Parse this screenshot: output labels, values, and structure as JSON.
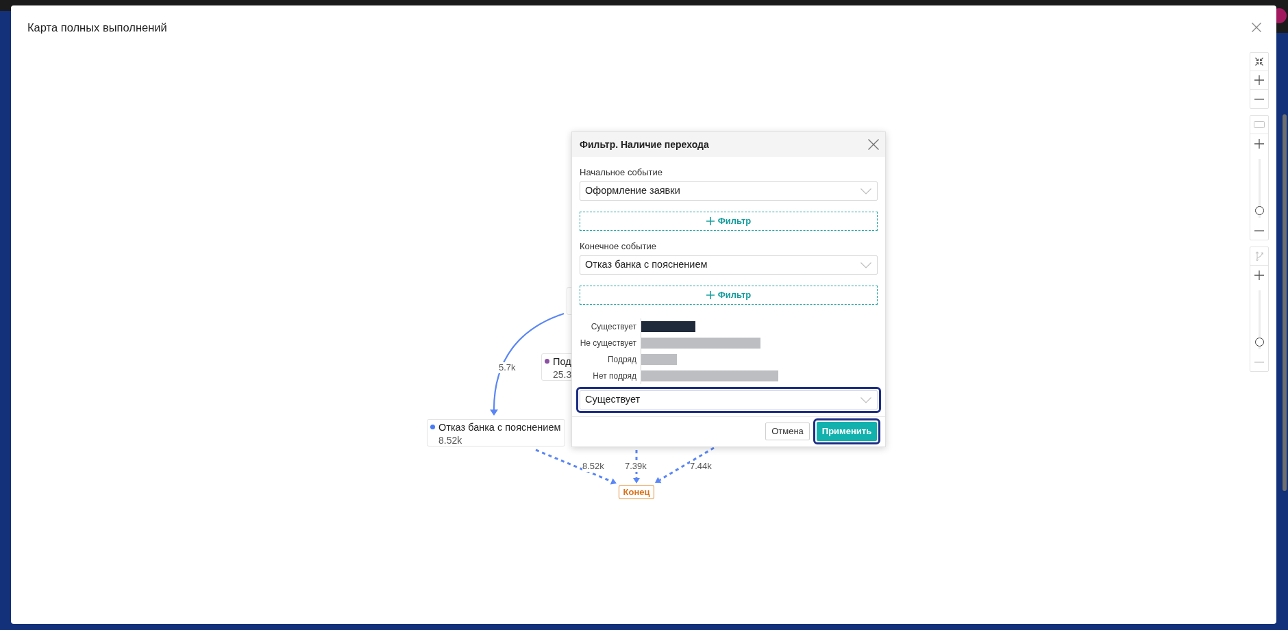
{
  "window": {
    "title": "Карта полных выполнений"
  },
  "graph": {
    "nodes": [
      {
        "kind": "covered"
      },
      {
        "kind": "event",
        "label": "Под",
        "value": "25.3",
        "color": "#8b4fa3"
      },
      {
        "kind": "event",
        "label": "Отказ банка с пояснением",
        "value": "8.52k",
        "color": "#4a7cf7"
      },
      {
        "kind": "end",
        "label": "Конец"
      }
    ],
    "edges": [
      {
        "label": "5.7k",
        "dashed": false
      },
      {
        "label": "8.52k",
        "dashed": true
      },
      {
        "label": "7.39k",
        "dashed": true
      },
      {
        "label": "7.44k",
        "dashed": true
      }
    ]
  },
  "filter_dialog": {
    "title": "Фильтр. Наличие перехода",
    "start_event": {
      "label": "Начальное событие",
      "value": "Оформление заявки",
      "filter_button": "Фильтр"
    },
    "end_event": {
      "label": "Конечное событие",
      "value": "Отказ банка с пояснением",
      "filter_button": "Фильтр"
    },
    "transition_chart": {
      "bars": [
        {
          "label": "Существует",
          "selected": true
        },
        {
          "label": "Не существует",
          "selected": false
        },
        {
          "label": "Подряд",
          "selected": false
        },
        {
          "label": "Нет подряд",
          "selected": false
        }
      ]
    },
    "transition_select": {
      "value": "Существует",
      "highlighted": true
    },
    "buttons": [
      {
        "label": "Отмена",
        "kind": "secondary",
        "highlighted": false
      },
      {
        "label": "Применить",
        "kind": "primary",
        "highlighted": true
      }
    ]
  },
  "toolbar": {
    "groups": [
      {
        "items": [
          {
            "kind": "fit",
            "disabled": false
          },
          {
            "kind": "plus",
            "disabled": false
          },
          {
            "kind": "minus",
            "disabled": false
          }
        ]
      },
      {
        "items": [
          {
            "kind": "frame",
            "disabled": true
          },
          {
            "kind": "plus",
            "disabled": false
          },
          {
            "kind": "slider",
            "level": 0.05
          },
          {
            "kind": "minus",
            "disabled": false
          }
        ]
      },
      {
        "items": [
          {
            "kind": "branch",
            "disabled": true
          },
          {
            "kind": "plus",
            "disabled": false
          },
          {
            "kind": "slider",
            "level": 0.05
          },
          {
            "kind": "minus",
            "disabled": true
          }
        ]
      }
    ]
  }
}
